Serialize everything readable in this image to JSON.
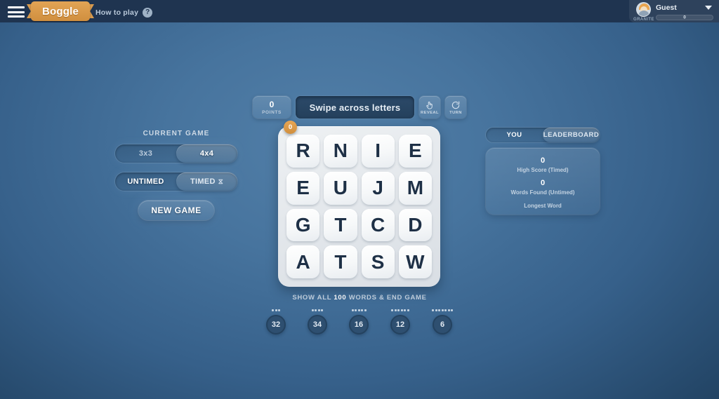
{
  "header": {
    "menu_icon": "hamburger-icon",
    "logo": "Boggle",
    "how_to_play": "How to play",
    "help_icon": "question-mark-icon"
  },
  "user": {
    "rank": "GRANITE",
    "name": "Guest",
    "xp": "0",
    "avatar_icon": "user-avatar-icon",
    "chevron_icon": "chevron-down-icon"
  },
  "left_panel": {
    "section_title": "CURRENT GAME",
    "size_options": [
      {
        "label": "3x3",
        "selected": false
      },
      {
        "label": "4x4",
        "selected": true
      }
    ],
    "mode_options": [
      {
        "label": "UNTIMED",
        "selected": true
      },
      {
        "label": "TIMED",
        "selected": false,
        "icon": "hourglass-icon",
        "glyph": "⧖"
      }
    ],
    "new_game_label": "NEW GAME"
  },
  "toolbar": {
    "points_value": "0",
    "points_label": "POINTS",
    "prompt": "Swipe across letters",
    "reveal_label": "REVEAL",
    "reveal_icon": "hand-pointer-icon",
    "turn_label": "TURN",
    "turn_icon": "rotate-icon"
  },
  "board": {
    "badge": "0",
    "rows": [
      [
        "R",
        "N",
        "I",
        "E"
      ],
      [
        "E",
        "U",
        "J",
        "M"
      ],
      [
        "G",
        "T",
        "C",
        "D"
      ],
      [
        "A",
        "T",
        "S",
        "W"
      ]
    ]
  },
  "words": {
    "prefix": "SHOW ALL",
    "total": "100",
    "suffix": "WORDS & END GAME",
    "counters": [
      {
        "length": 3,
        "count": "32"
      },
      {
        "length": 4,
        "count": "34"
      },
      {
        "length": 5,
        "count": "16"
      },
      {
        "length": 6,
        "count": "12"
      },
      {
        "length": 7,
        "count": "6"
      }
    ]
  },
  "right_panel": {
    "tabs": [
      {
        "label": "YOU",
        "active": true
      },
      {
        "label": "LEADERBOARD",
        "active": false
      }
    ],
    "stats": [
      {
        "value": "0",
        "label": "High Score (Timed)"
      },
      {
        "value": "0",
        "label": "Words Found (Untimed)"
      }
    ],
    "longest_word_label": "Longest Word"
  },
  "colors": {
    "accent_orange": "#d79a4e",
    "header_navy": "#1f3450",
    "board_light": "#e8ecef",
    "tile_text": "#1e3046"
  }
}
